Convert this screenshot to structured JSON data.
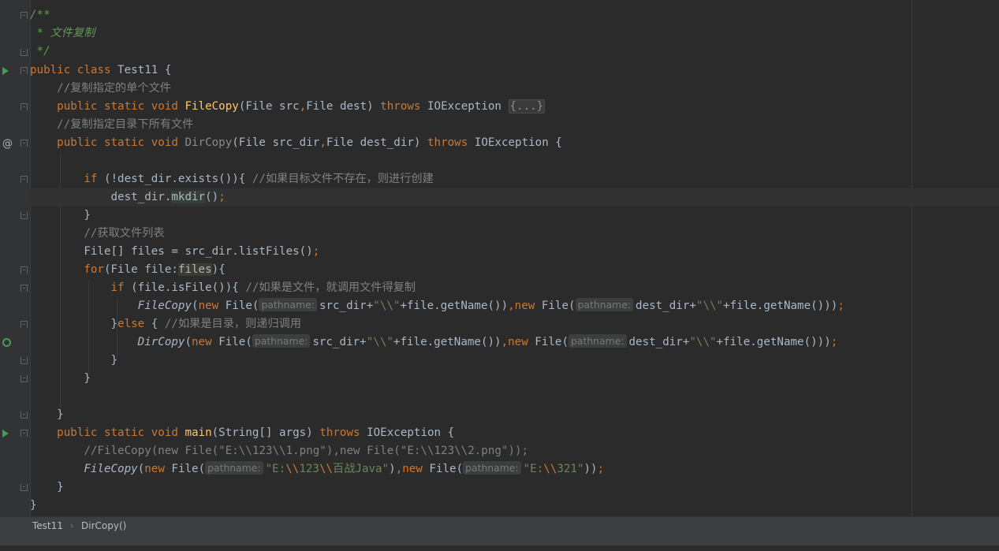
{
  "lines": {
    "l1": "/**",
    "l2": " * 文件复制",
    "l3": " */",
    "l4_kw": "public class ",
    "l4_name": "Test11 {",
    "l5": "    //复制指定的单个文件",
    "l6_kw1": "    public static void ",
    "l6_fn": "FileCopy",
    "l6_a": "(File src",
    "l6_c": ",",
    "l6_b": "File dest) ",
    "l6_kw2": "throws ",
    "l6_ex": "IOException ",
    "l6_fold": "{...}",
    "l7": "    //复制指定目录下所有文件",
    "l8_kw1": "    public static void ",
    "l8_fn": "DirCopy",
    "l8_a": "(File src_dir",
    "l8_c": ",",
    "l8_b": "File dest_dir) ",
    "l8_kw2": "throws ",
    "l8_ex": "IOException {",
    "l10_kw": "        if ",
    "l10_code": "(!dest_dir.exists()){ ",
    "l10_cm": "//如果目标文件不存在，则进行创建",
    "l11_a": "            dest_dir.",
    "l11_m": "mkdir",
    "l11_b": "()",
    "l11_c": ";",
    "l12": "        }",
    "l13": "        //获取文件列表",
    "l14_a": "        File[] files = src_dir.listFiles()",
    "l14_c": ";",
    "l15_kw": "        for",
    "l15_a": "(File file:",
    "l15_r": "files",
    "l15_b": "){",
    "l16_kw": "            if ",
    "l16_code": "(file.isFile()){ ",
    "l16_cm": "//如果是文件，就调用文件得复制",
    "l17_ind": "                ",
    "l17_fn": "FileCopy",
    "l17_p1": "(",
    "l17_new1": "new ",
    "l17_f1": "File(",
    "l17_h1": "pathname:",
    "l17_v1": "src_dir+",
    "l17_s1": "\"\\\\\"",
    "l17_r1": "+file.getName())",
    "l17_c1": ",",
    "l17_new2": "new ",
    "l17_f2": "File(",
    "l17_h2": "pathname:",
    "l17_v2": "dest_dir+",
    "l17_s2": "\"\\\\\"",
    "l17_r2": "+file.getName()))",
    "l17_c2": ";",
    "l18_a": "            }",
    "l18_kw": "else ",
    "l18_b": "{ ",
    "l18_cm": "//如果是目录，则递归调用",
    "l19_ind": "                ",
    "l19_fn": "DirCopy",
    "l19_p1": "(",
    "l19_new1": "new ",
    "l19_f1": "File(",
    "l19_h1": "pathname:",
    "l19_v1": "src_dir+",
    "l19_s1": "\"\\\\\"",
    "l19_r1": "+file.getName())",
    "l19_c1": ",",
    "l19_new2": "new ",
    "l19_f2": "File(",
    "l19_h2": "pathname:",
    "l19_v2": "dest_dir+",
    "l19_s2": "\"\\\\\"",
    "l19_r2": "+file.getName()))",
    "l19_c2": ";",
    "l20": "            }",
    "l21": "        }",
    "l23": "    }",
    "l24_kw1": "    public static void ",
    "l24_fn": "main",
    "l24_a": "(String[] args) ",
    "l24_kw2": "throws ",
    "l24_ex": "IOException {",
    "l25": "        //FileCopy(new File(\"E:\\\\123\\\\1.png\"),new File(\"E:\\\\123\\\\2.png\"));",
    "l26_ind": "        ",
    "l26_fn": "FileCopy",
    "l26_p1": "(",
    "l26_new1": "new ",
    "l26_f1": "File(",
    "l26_h1": "pathname:",
    "l26_s1": "\"E:",
    "l26_e1": "\\\\",
    "l26_s2": "123",
    "l26_e2": "\\\\",
    "l26_s3": "百战Java\"",
    "l26_r1": ")",
    "l26_c1": ",",
    "l26_new2": "new ",
    "l26_f2": "File(",
    "l26_h2": "pathname:",
    "l26_s4": "\"E:",
    "l26_e3": "\\\\",
    "l26_s5": "321\"",
    "l26_r2": "))",
    "l26_c2": ";",
    "l27": "    }",
    "l28": "}"
  },
  "breadcrumb": {
    "class_name": "Test11",
    "separator": "›",
    "method_name": "DirCopy()"
  },
  "colors": {
    "background": "#2b2b2b",
    "keyword": "#cc7832",
    "comment": "#808080",
    "doc_comment": "#629755",
    "string": "#6a8759",
    "method_decl": "#ffc66d",
    "text": "#a9b7c6"
  },
  "icons": [
    "run-icon",
    "override-icon",
    "recursive-call-icon",
    "fold-icon"
  ]
}
